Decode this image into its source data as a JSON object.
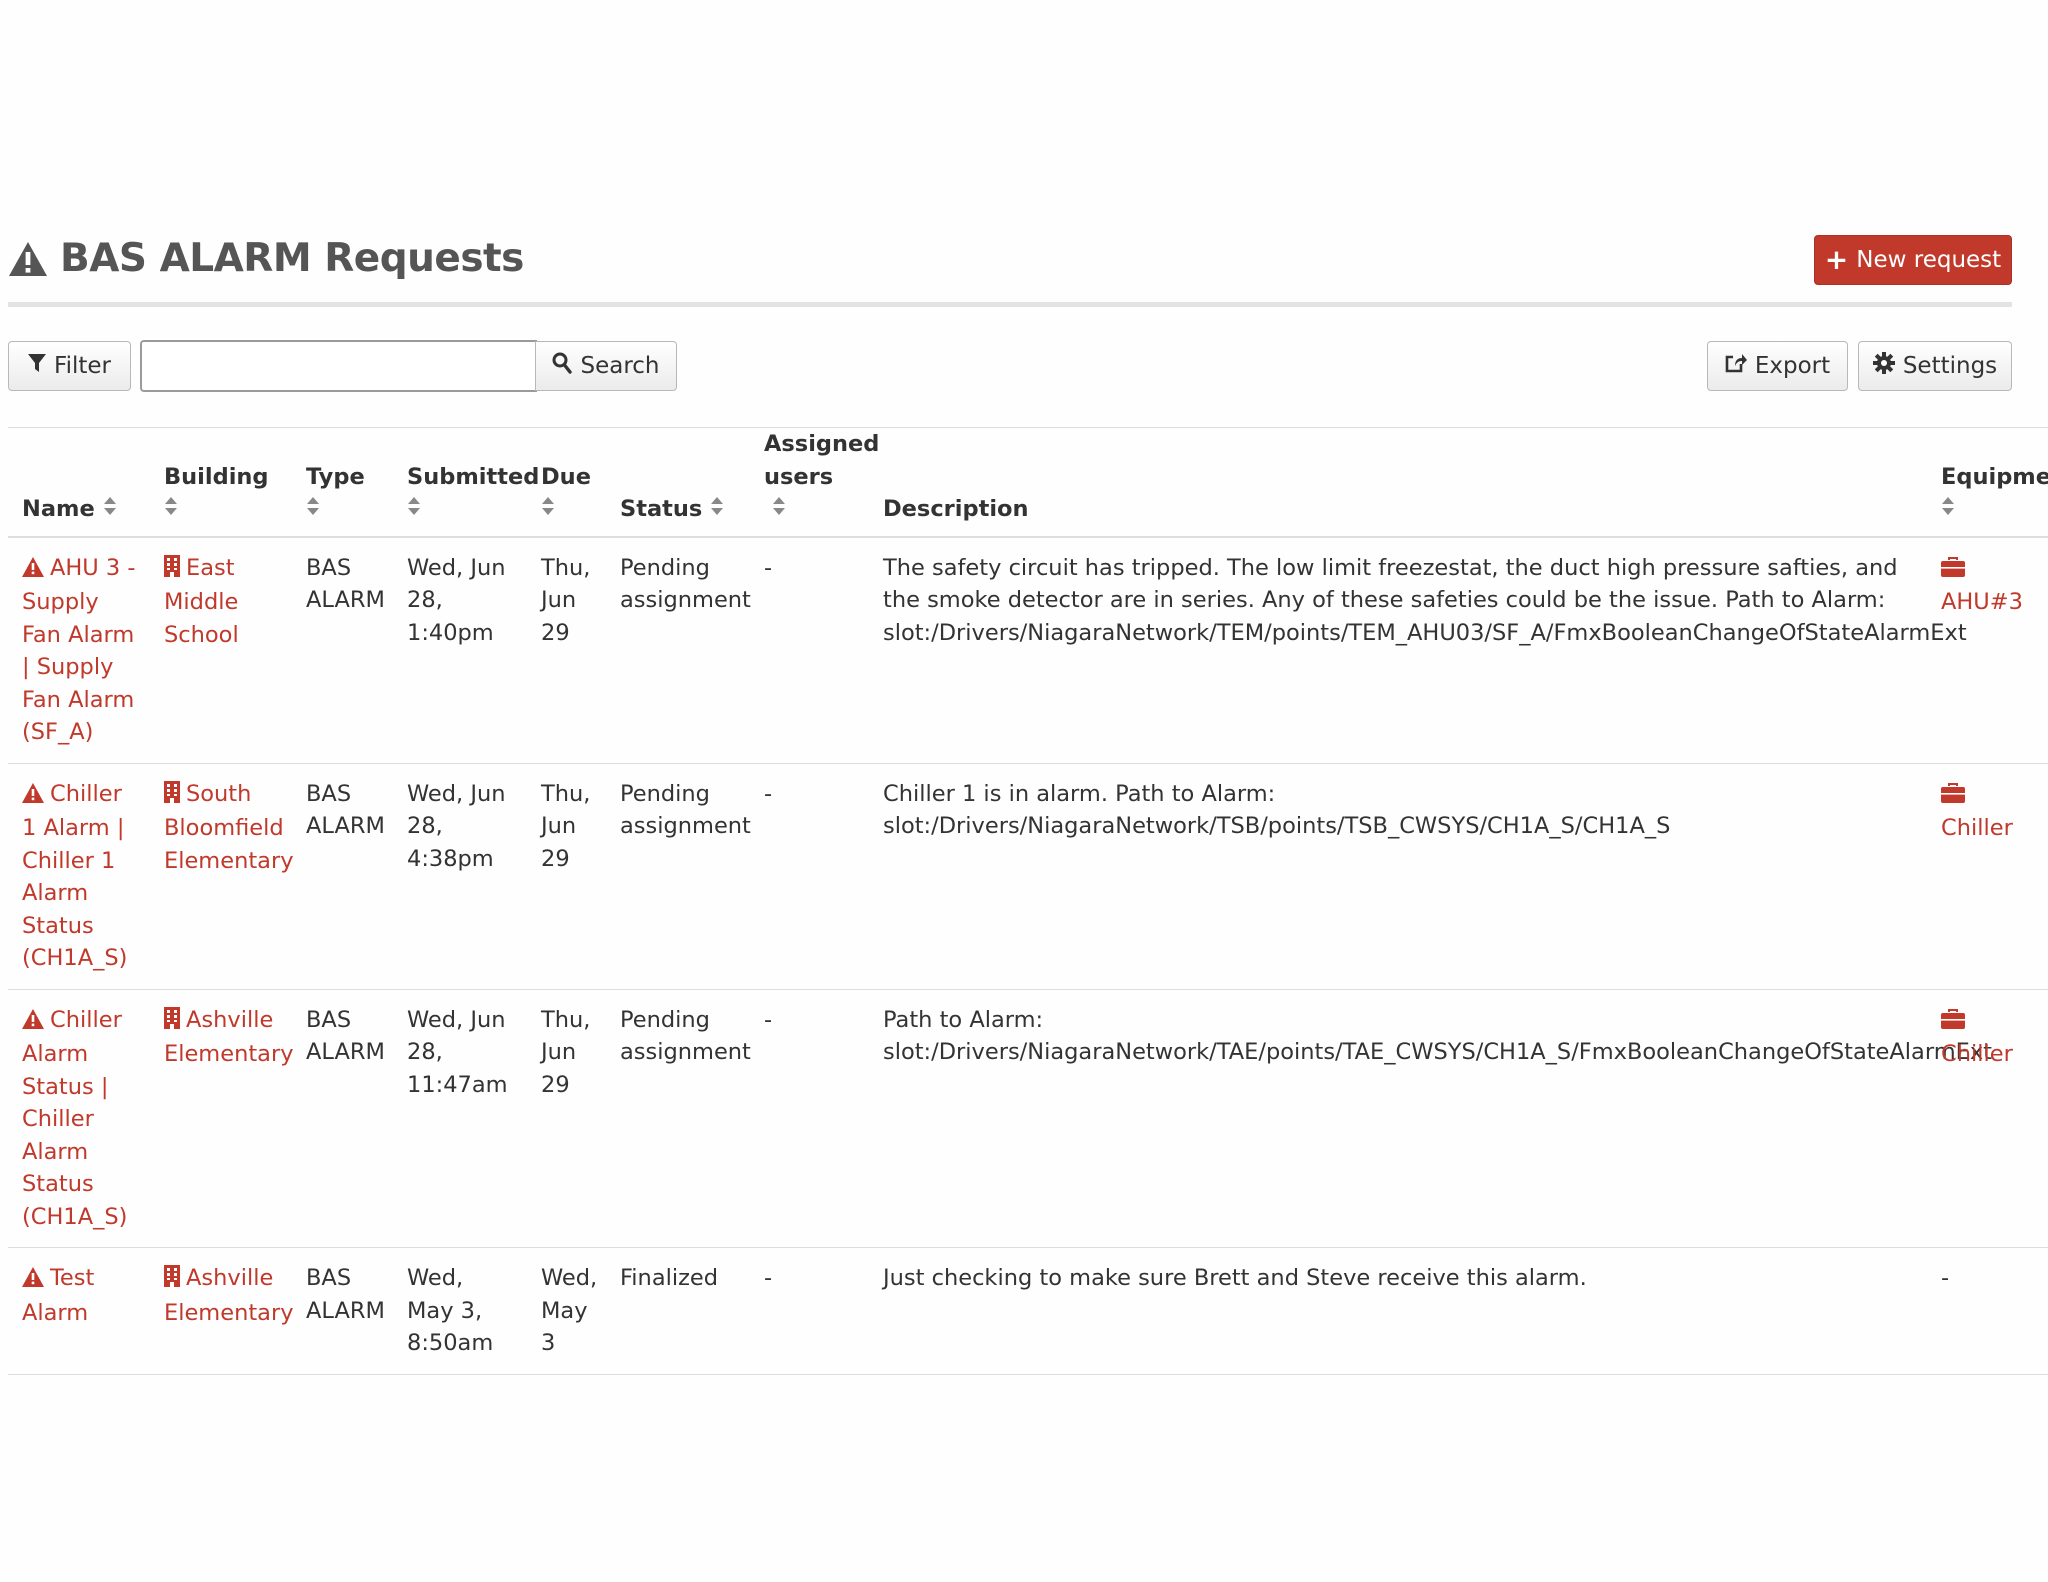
{
  "header": {
    "title": "BAS ALARM Requests",
    "title_icon": "warning-triangle-icon",
    "new_request_label": "New request"
  },
  "toolbar": {
    "filter_label": "Filter",
    "search_value": "",
    "search_placeholder": "",
    "search_label": "Search",
    "export_label": "Export",
    "settings_label": "Settings"
  },
  "table": {
    "columns": {
      "name": "Name",
      "building": "Building",
      "type": "Type",
      "submitted": "Submitted",
      "due": "Due",
      "status": "Status",
      "assigned_l1": "Assigned",
      "assigned_l2": "users",
      "description": "Description",
      "equipment": "Equipment"
    },
    "rows": [
      {
        "name": "AHU 3 - Supply Fan Alarm | Supply Fan Alarm (SF_A)",
        "building": "East Middle School",
        "type": "BAS ALARM",
        "submitted": "Wed, Jun 28, 1:40pm",
        "due": "Thu, Jun 29",
        "status": "Pending assignment",
        "assigned": "-",
        "description": "The safety circuit has tripped. The low limit freezestat, the duct high pressure safties, and the smoke detector are in series. Any of these safeties could be the issue. Path to Alarm: slot:/Drivers/NiagaraNetwork/TEM/points/TEM_AHU03/SF_A/FmxBooleanChangeOfStateAlarmExt",
        "equipment": "AHU#3"
      },
      {
        "name": "Chiller 1 Alarm | Chiller 1 Alarm Status (CH1A_S)",
        "building": "South Bloomfield Elementary",
        "type": "BAS ALARM",
        "submitted": "Wed, Jun 28, 4:38pm",
        "due": "Thu, Jun 29",
        "status": "Pending assignment",
        "assigned": "-",
        "description": "Chiller 1 is in alarm. Path to Alarm: slot:/Drivers/NiagaraNetwork/TSB/points/TSB_CWSYS/CH1A_S/CH1A_S",
        "equipment": "Chiller"
      },
      {
        "name": "Chiller Alarm Status | Chiller Alarm Status (CH1A_S)",
        "building": "Ashville Elementary",
        "type": "BAS ALARM",
        "submitted": "Wed, Jun 28, 11:47am",
        "due": "Thu, Jun 29",
        "status": "Pending assignment",
        "assigned": "-",
        "description": "Path to Alarm: slot:/Drivers/NiagaraNetwork/TAE/points/TAE_CWSYS/CH1A_S/FmxBooleanChangeOfStateAlarmExt",
        "equipment": "Chiller"
      },
      {
        "name": "Test Alarm",
        "building": "Ashville Elementary",
        "type": "BAS ALARM",
        "submitted": "Wed, May 3, 8:50am",
        "due": "Wed, May 3",
        "status": "Finalized",
        "assigned": "-",
        "description": "Just checking to make sure Brett and Steve receive this alarm.",
        "equipment": "-"
      }
    ]
  },
  "colors": {
    "accent": "#c0392b",
    "text": "#333333",
    "header_text": "#555555",
    "border": "#dddddd"
  },
  "icons": {
    "row_name": "warning-triangle-icon",
    "building": "building-icon",
    "equipment": "briefcase-icon",
    "filter": "funnel-icon",
    "search": "magnifier-icon",
    "export": "share-out-icon",
    "settings": "gear-icon",
    "new": "plus-icon",
    "sort": "sort-icon"
  }
}
